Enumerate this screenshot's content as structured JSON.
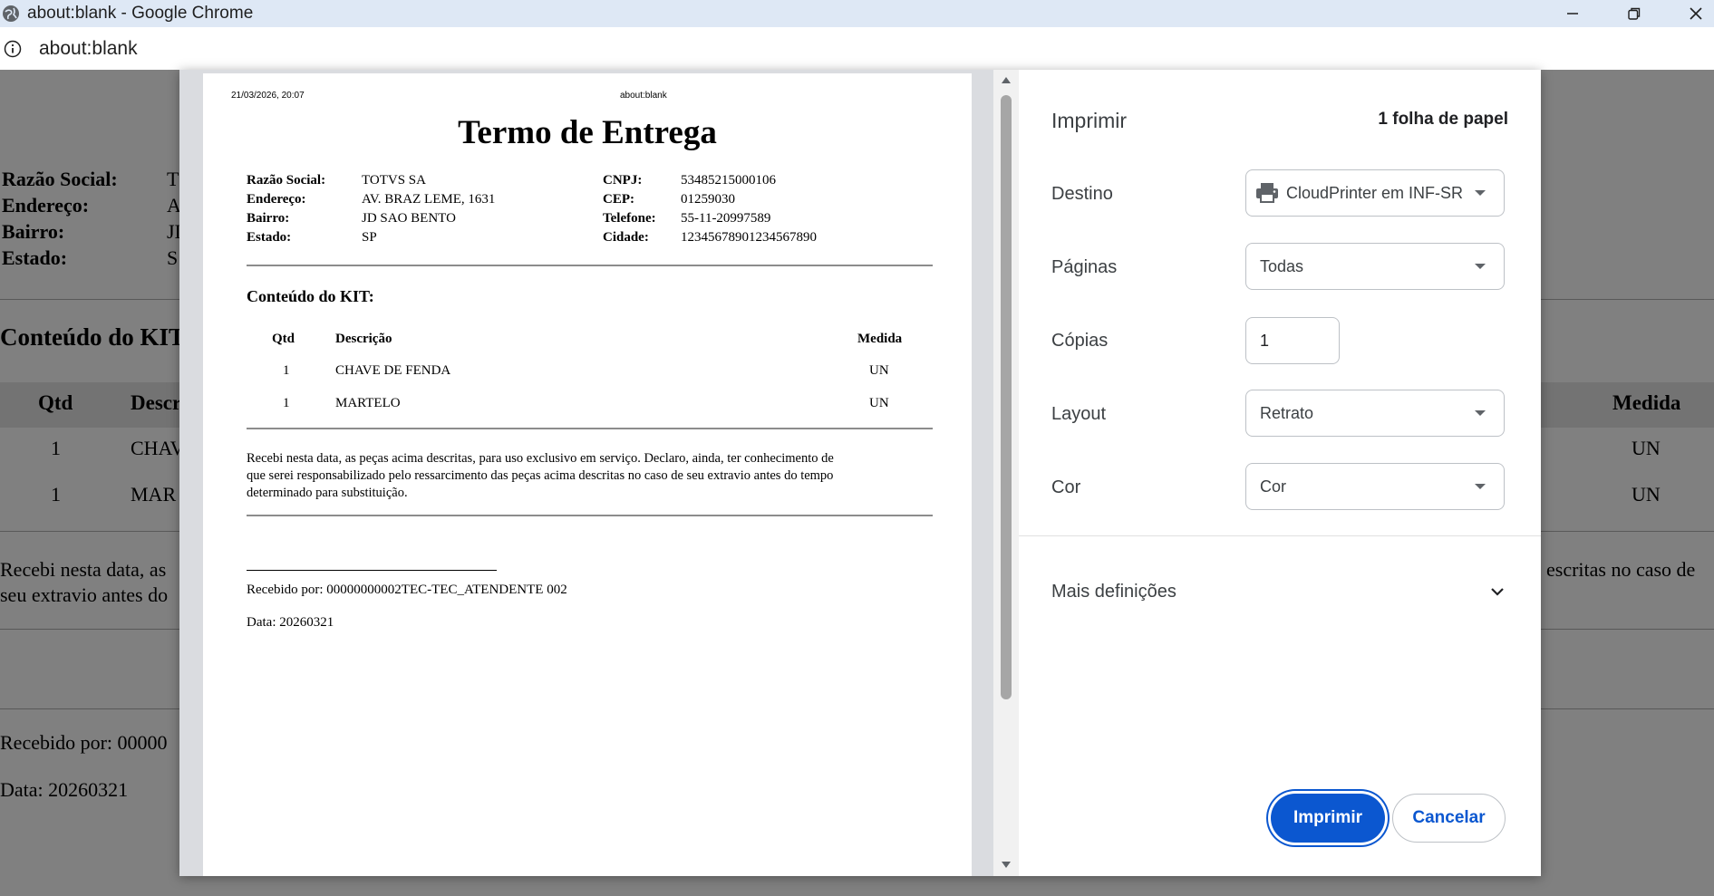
{
  "window": {
    "title": "about:blank - Google Chrome"
  },
  "address_bar": {
    "url": "about:blank"
  },
  "background_page": {
    "labels": [
      "Razão Social:",
      "Endereço:",
      "Bairro:",
      "Estado:"
    ],
    "values": [
      "T",
      "A",
      "JI",
      "S"
    ],
    "kit_heading": "Conteúdo do KIT",
    "col_qtd": "Qtd",
    "col_desc": "Descr",
    "col_medida": "Medida",
    "rows": [
      {
        "qtd": "1",
        "desc": "CHAV",
        "medida": "UN"
      },
      {
        "qtd": "1",
        "desc": "MAR",
        "medida": "UN"
      }
    ],
    "text_left_1": "Recebi nesta data, as",
    "text_left_2": "seu extravio antes do",
    "text_right_1": "escritas no caso de",
    "received": "Recebido por: 00000",
    "date": "Data: 20260321"
  },
  "document": {
    "header_datetime": "21/03/2026, 20:07",
    "header_url": "about:blank",
    "title": "Termo de Entrega",
    "fields_left": [
      {
        "label": "Razão Social:",
        "value": "TOTVS SA"
      },
      {
        "label": "Endereço:",
        "value": "AV. BRAZ LEME, 1631"
      },
      {
        "label": "Bairro:",
        "value": "JD SAO BENTO"
      },
      {
        "label": "Estado:",
        "value": "SP"
      }
    ],
    "fields_right": [
      {
        "label": "CNPJ:",
        "value": "53485215000106"
      },
      {
        "label": "CEP:",
        "value": "01259030"
      },
      {
        "label": "Telefone:",
        "value": "55-11-20997589"
      },
      {
        "label": "Cidade:",
        "value": "12345678901234567890"
      }
    ],
    "kit_heading": "Conteúdo do KIT:",
    "table_headers": {
      "qtd": "Qtd",
      "descricao": "Descrição",
      "medida": "Medida"
    },
    "items": [
      {
        "qtd": "1",
        "descricao": "CHAVE DE FENDA",
        "medida": "UN"
      },
      {
        "qtd": "1",
        "descricao": "MARTELO",
        "medida": "UN"
      }
    ],
    "declaration_lines": [
      "Recebi nesta data, as peças acima descritas, para uso exclusivo em serviço. Declaro, ainda, ter conhecimento de",
      "que serei responsabilizado pelo ressarcimento das peças acima descritas no caso de seu extravio antes do tempo",
      "determinado para substituição."
    ],
    "received_by": "Recebido por: 00000000002TEC-TEC_ATENDENTE 002",
    "date": "Data: 20260321"
  },
  "print_settings": {
    "heading": "Imprimir",
    "sheets": "1 folha de papel",
    "destination_label": "Destino",
    "destination_value": "CloudPrinter em INF-SR",
    "pages_label": "Páginas",
    "pages_value": "Todas",
    "copies_label": "Cópias",
    "copies_value": "1",
    "layout_label": "Layout",
    "layout_value": "Retrato",
    "color_label": "Cor",
    "color_value": "Cor",
    "more_settings": "Mais definições",
    "print_button": "Imprimir",
    "cancel_button": "Cancelar"
  },
  "colors": {
    "accent": "#0b57d0",
    "titlebar": "#dee8f5",
    "overlay": "#808080"
  }
}
